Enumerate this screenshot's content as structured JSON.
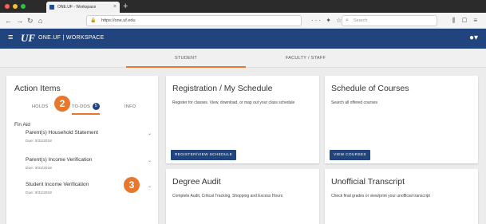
{
  "browser": {
    "tab_title": "ONE.UF - Workspace",
    "url": "https://one.uf.edu",
    "search_placeholder": "Search"
  },
  "app": {
    "logo": "UF",
    "title": "ONE.UF | WORKSPACE",
    "brand_color": "#21447f",
    "accent_color": "#e8772e"
  },
  "role_tabs": [
    {
      "label": "STUDENT",
      "active": true
    },
    {
      "label": "FACULTY / STAFF",
      "active": false
    }
  ],
  "action_items": {
    "title": "Action Items",
    "tabs": {
      "holds": "HOLDS",
      "todo": "TO-DOS",
      "todo_count": "5",
      "info": "INFO"
    },
    "group": "Fin Aid",
    "items": [
      {
        "title": "Parent(s) Household Statement",
        "due": "Due: 3/31/2018"
      },
      {
        "title": "Parent(s) Income Verification",
        "due": "Due: 3/31/2018"
      },
      {
        "title": "Student Income Verification",
        "due": "Due: 3/31/2018"
      }
    ]
  },
  "callouts": {
    "todos": "2",
    "item": "3"
  },
  "cards": {
    "registration": {
      "title": "Registration / My Schedule",
      "text": "Register for classes. View, download, or map out your class schedule",
      "button": "REGISTER/VIEW SCHEDULE"
    },
    "schedule": {
      "title": "Schedule of Courses",
      "text": "Search all offered courses",
      "button": "VIEW COURSES"
    },
    "degree": {
      "title": "Degree Audit",
      "text": "Complete Audit, Critical Tracking, Shopping and Excess Hours"
    },
    "transcript": {
      "title": "Unofficial Transcript",
      "text": "Check final grades or view/print your unofficial transcript"
    }
  }
}
